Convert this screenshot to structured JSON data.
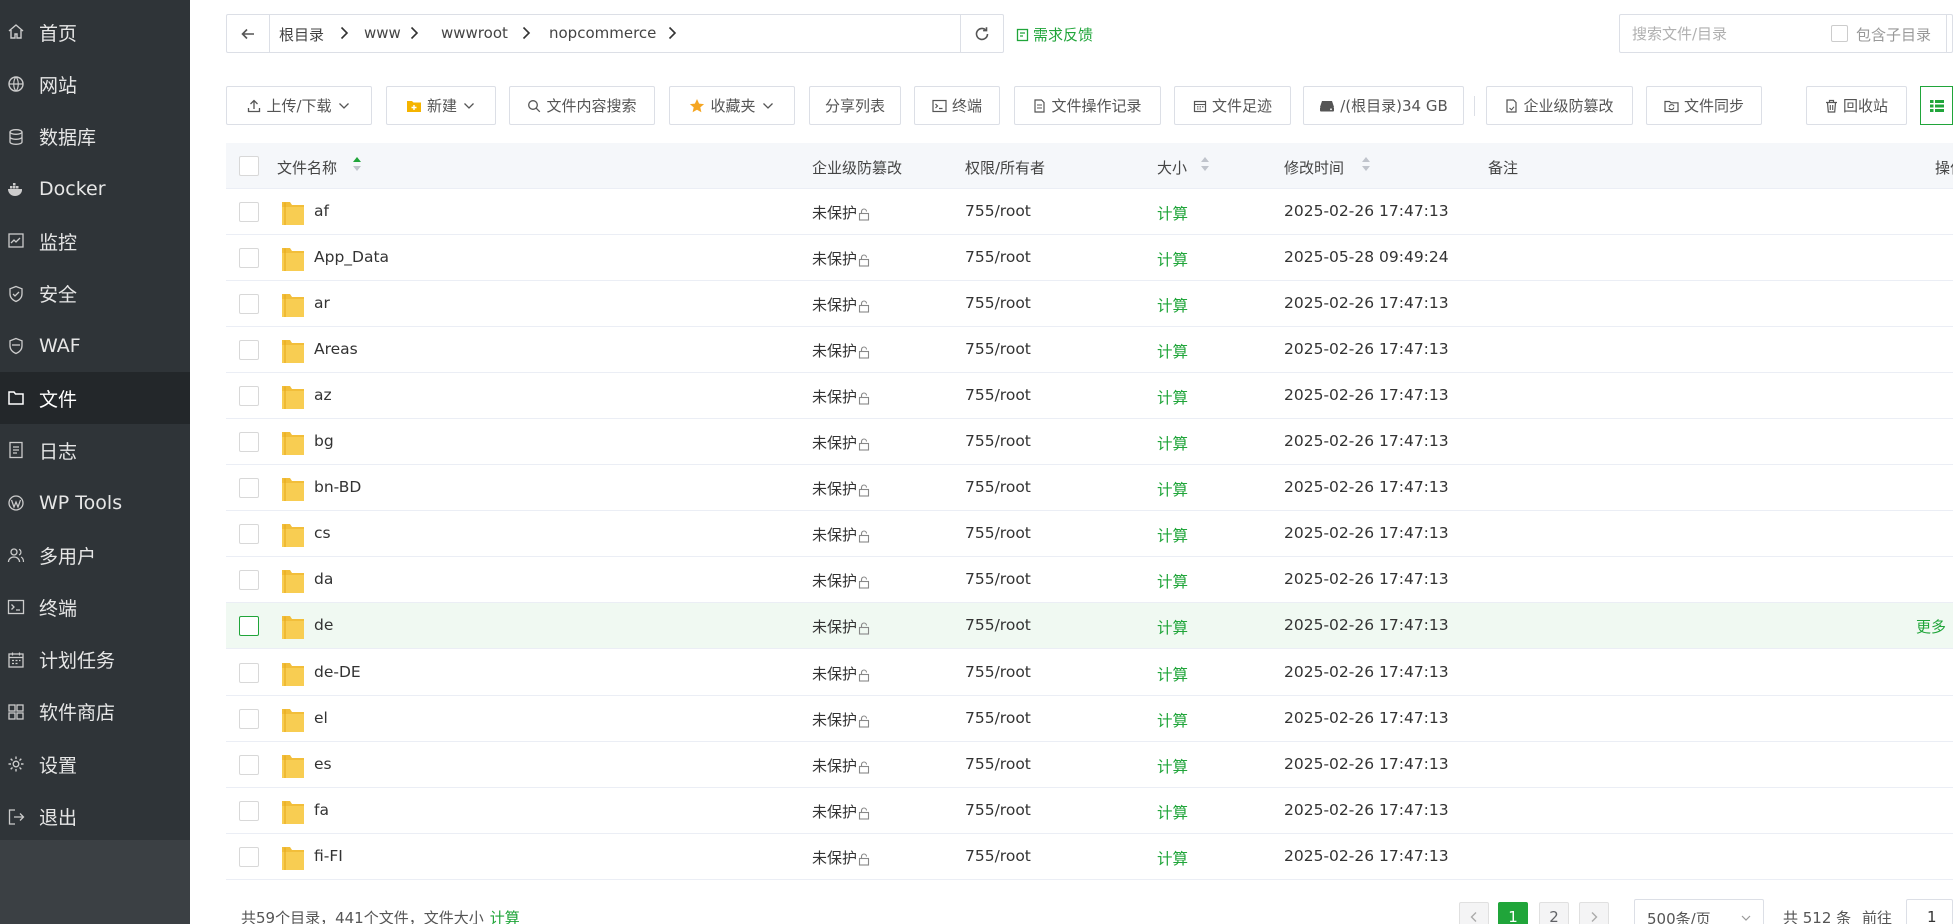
{
  "sidebar": {
    "items": [
      {
        "label": "首页",
        "icon": "home-icon"
      },
      {
        "label": "网站",
        "icon": "globe-icon"
      },
      {
        "label": "数据库",
        "icon": "database-icon"
      },
      {
        "label": "Docker",
        "icon": "docker-icon"
      },
      {
        "label": "监控",
        "icon": "monitor-icon"
      },
      {
        "label": "安全",
        "icon": "shield-icon"
      },
      {
        "label": "WAF",
        "icon": "waf-shield-icon"
      },
      {
        "label": "文件",
        "icon": "folder-icon",
        "active": true
      },
      {
        "label": "日志",
        "icon": "log-icon"
      },
      {
        "label": "WP Tools",
        "icon": "wordpress-icon"
      },
      {
        "label": "多用户",
        "icon": "users-icon"
      },
      {
        "label": "终端",
        "icon": "terminal-icon"
      },
      {
        "label": "计划任务",
        "icon": "calendar-icon"
      },
      {
        "label": "软件商店",
        "icon": "apps-icon"
      },
      {
        "label": "设置",
        "icon": "gear-icon"
      },
      {
        "label": "退出",
        "icon": "logout-icon"
      }
    ]
  },
  "path": {
    "crumbs": [
      "根目录",
      "www",
      "wwwroot",
      "nopcommerce"
    ]
  },
  "feedback_label": "需求反馈",
  "search": {
    "placeholder": "搜索文件/目录",
    "include_sub_label": "包含子目录"
  },
  "toolbar": {
    "upload": "上传/下载",
    "new": "新建",
    "content_search": "文件内容搜索",
    "favorites": "收藏夹",
    "share_list": "分享列表",
    "terminal": "终端",
    "op_log": "文件操作记录",
    "footprint": "文件足迹",
    "disk": "/(根目录)34 GB",
    "tamper": "企业级防篡改",
    "sync": "文件同步",
    "recycle": "回收站"
  },
  "table": {
    "headers": {
      "name": "文件名称",
      "protect": "企业级防篡改",
      "perm": "权限/所有者",
      "size": "大小",
      "mtime": "修改时间",
      "note": "备注",
      "ops": "操作"
    },
    "rows": [
      {
        "name": "af",
        "protect": "未保护",
        "perm": "755/root",
        "size": "计算",
        "mtime": "2025-02-26 17:47:13"
      },
      {
        "name": "App_Data",
        "protect": "未保护",
        "perm": "755/root",
        "size": "计算",
        "mtime": "2025-05-28 09:49:24"
      },
      {
        "name": "ar",
        "protect": "未保护",
        "perm": "755/root",
        "size": "计算",
        "mtime": "2025-02-26 17:47:13"
      },
      {
        "name": "Areas",
        "protect": "未保护",
        "perm": "755/root",
        "size": "计算",
        "mtime": "2025-02-26 17:47:13"
      },
      {
        "name": "az",
        "protect": "未保护",
        "perm": "755/root",
        "size": "计算",
        "mtime": "2025-02-26 17:47:13"
      },
      {
        "name": "bg",
        "protect": "未保护",
        "perm": "755/root",
        "size": "计算",
        "mtime": "2025-02-26 17:47:13"
      },
      {
        "name": "bn-BD",
        "protect": "未保护",
        "perm": "755/root",
        "size": "计算",
        "mtime": "2025-02-26 17:47:13"
      },
      {
        "name": "cs",
        "protect": "未保护",
        "perm": "755/root",
        "size": "计算",
        "mtime": "2025-02-26 17:47:13"
      },
      {
        "name": "da",
        "protect": "未保护",
        "perm": "755/root",
        "size": "计算",
        "mtime": "2025-02-26 17:47:13"
      },
      {
        "name": "de",
        "protect": "未保护",
        "perm": "755/root",
        "size": "计算",
        "mtime": "2025-02-26 17:47:13",
        "hover": true,
        "more": "更多"
      },
      {
        "name": "de-DE",
        "protect": "未保护",
        "perm": "755/root",
        "size": "计算",
        "mtime": "2025-02-26 17:47:13"
      },
      {
        "name": "el",
        "protect": "未保护",
        "perm": "755/root",
        "size": "计算",
        "mtime": "2025-02-26 17:47:13"
      },
      {
        "name": "es",
        "protect": "未保护",
        "perm": "755/root",
        "size": "计算",
        "mtime": "2025-02-26 17:47:13"
      },
      {
        "name": "fa",
        "protect": "未保护",
        "perm": "755/root",
        "size": "计算",
        "mtime": "2025-02-26 17:47:13"
      },
      {
        "name": "fi-FI",
        "protect": "未保护",
        "perm": "755/root",
        "size": "计算",
        "mtime": "2025-02-26 17:47:13"
      }
    ]
  },
  "footer": {
    "summary": "共59个目录，441个文件，文件大小",
    "calc_label": "计算",
    "pages": [
      "1",
      "2"
    ],
    "current_page": "1",
    "page_size": "500条/页",
    "total": "共 512 条",
    "goto_label": "前往",
    "goto_value": "1"
  },
  "colors": {
    "accent": "#20a53a",
    "sidebar_bg": "#2f3438",
    "sidebar_active": "#23272a"
  }
}
